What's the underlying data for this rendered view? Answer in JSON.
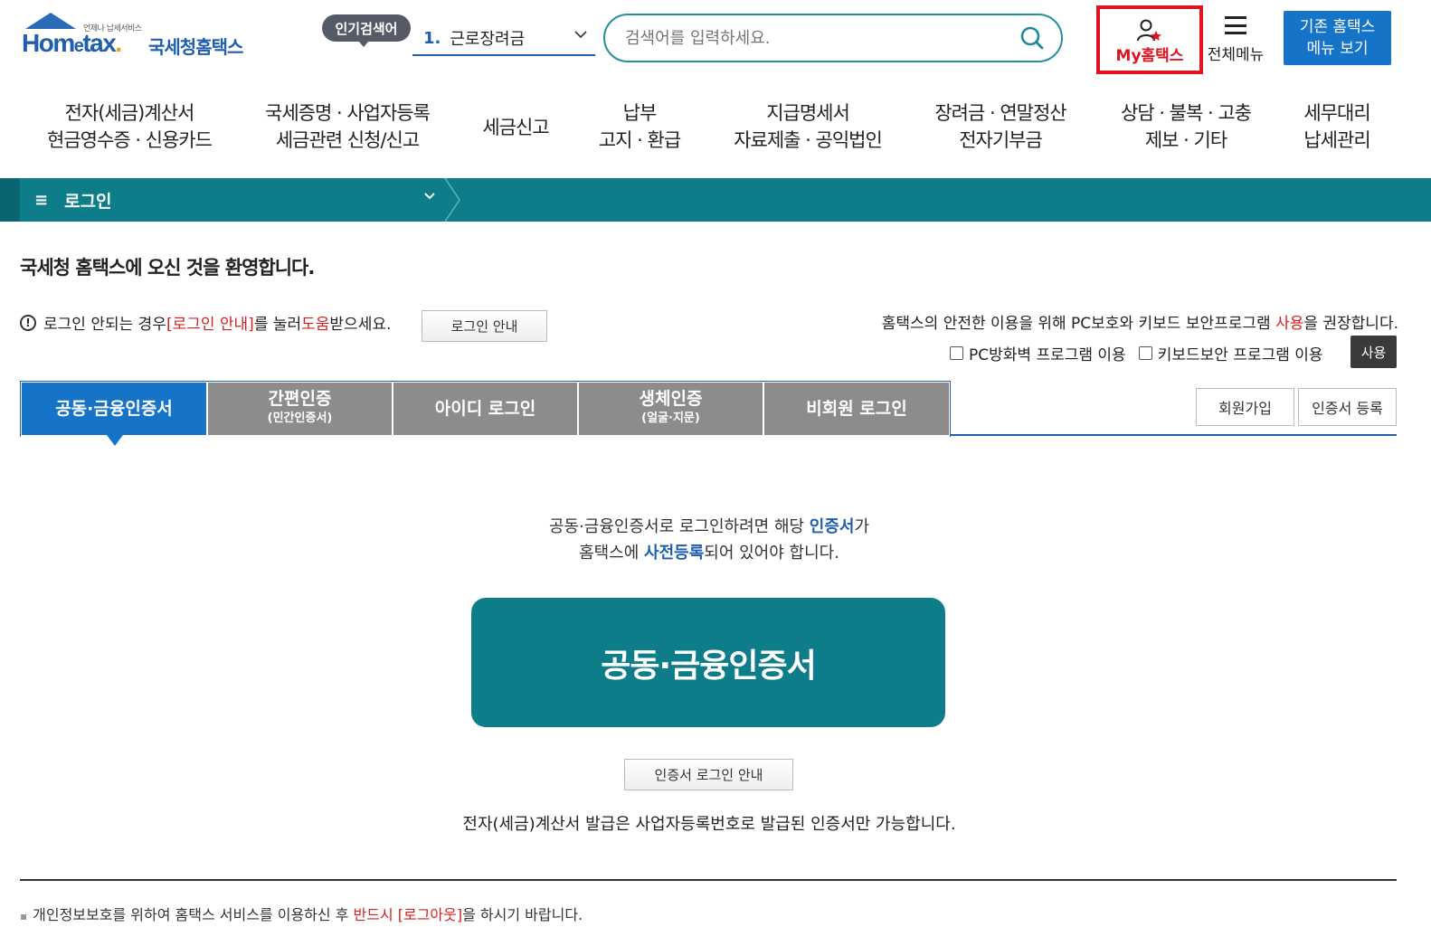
{
  "header": {
    "logo_small": "언제나 납세서비스",
    "logo_brand_home": "Hom",
    "logo_brand_e": "e",
    "logo_brand_tax": "tax",
    "logo_brand_dot": ".",
    "logo_name": "국세청홈택스",
    "popular_label": "인기검색어",
    "popular_num": "1.",
    "popular_value": "근로장려금",
    "search_placeholder": "검색어를 입력하세요.",
    "my_hometax": "My홈택스",
    "all_menu": "전체메뉴",
    "old_menu_line1": "기존 홈택스",
    "old_menu_line2": "메뉴 보기"
  },
  "nav": [
    {
      "l1": "전자(세금)계산서",
      "l2": "현금영수증 · 신용카드"
    },
    {
      "l1": "국세증명 · 사업자등록",
      "l2": "세금관련 신청/신고"
    },
    {
      "l1": "세금신고",
      "l2": ""
    },
    {
      "l1": "납부",
      "l2": "고지 · 환급"
    },
    {
      "l1": "지급명세서",
      "l2": "자료제출 · 공익법인"
    },
    {
      "l1": "장려금 · 연말정산",
      "l2": "전자기부금"
    },
    {
      "l1": "상담 · 불복 · 고충",
      "l2": "제보 · 기타"
    },
    {
      "l1": "세무대리",
      "l2": "납세관리"
    }
  ],
  "breadcrumb": {
    "current": "로그인"
  },
  "content": {
    "welcome": "국세청 홈택스에 오신 것을 환영합니다.",
    "help_prefix": "로그인 안되는 경우 ",
    "help_link": "[로그인 안내]",
    "help_mid": "를 눌러 ",
    "help_red": "도움",
    "help_suffix": "받으세요.",
    "login_guide_btn": "로그인 안내",
    "security_prefix": "홈택스의 안전한 이용을 위해 PC보호와 키보드 보안프로그램 ",
    "security_red": "사용",
    "security_suffix": "을 권장합니다.",
    "opt_firewall": "PC방화벽 프로그램 이용",
    "opt_keyboard": "키보드보안 프로그램 이용",
    "use_btn": "사용"
  },
  "tabs": [
    {
      "label": "공동·금융인증서",
      "sub": ""
    },
    {
      "label": "간편인증",
      "sub": "(민간인증서)"
    },
    {
      "label": "아이디 로그인",
      "sub": ""
    },
    {
      "label": "생체인증",
      "sub": "(얼굴·지문)"
    },
    {
      "label": "비회원 로그인",
      "sub": ""
    }
  ],
  "side_buttons": {
    "join": "회원가입",
    "cert_register": "인증서 등록"
  },
  "cert": {
    "desc1_prefix": "공동·금융인증서로 로그인하려면 해당 ",
    "desc1_blue": "인증서",
    "desc1_suffix": "가",
    "desc2_prefix": "홈택스에 ",
    "desc2_blue": "사전등록",
    "desc2_suffix": "되어 있어야 합니다.",
    "big_button": "공동·금융인증서",
    "guide_button": "인증서 로그인 안내",
    "tax_note": "전자(세금)계산서 발급은 사업자등록번호로 발급된 인증서만 가능합니다."
  },
  "footer": {
    "bullet": "▪",
    "privacy_prefix": "개인정보보호를 위하여 홈택스 서비스를 이용하신 후 ",
    "privacy_red": "반드시 [로그아웃]",
    "privacy_suffix": "을 하시기 바랍니다."
  },
  "colors": {
    "teal": "#0c7d89",
    "blue": "#1674c8",
    "red": "#e0141e",
    "tab_gray": "#8c8c8c"
  }
}
